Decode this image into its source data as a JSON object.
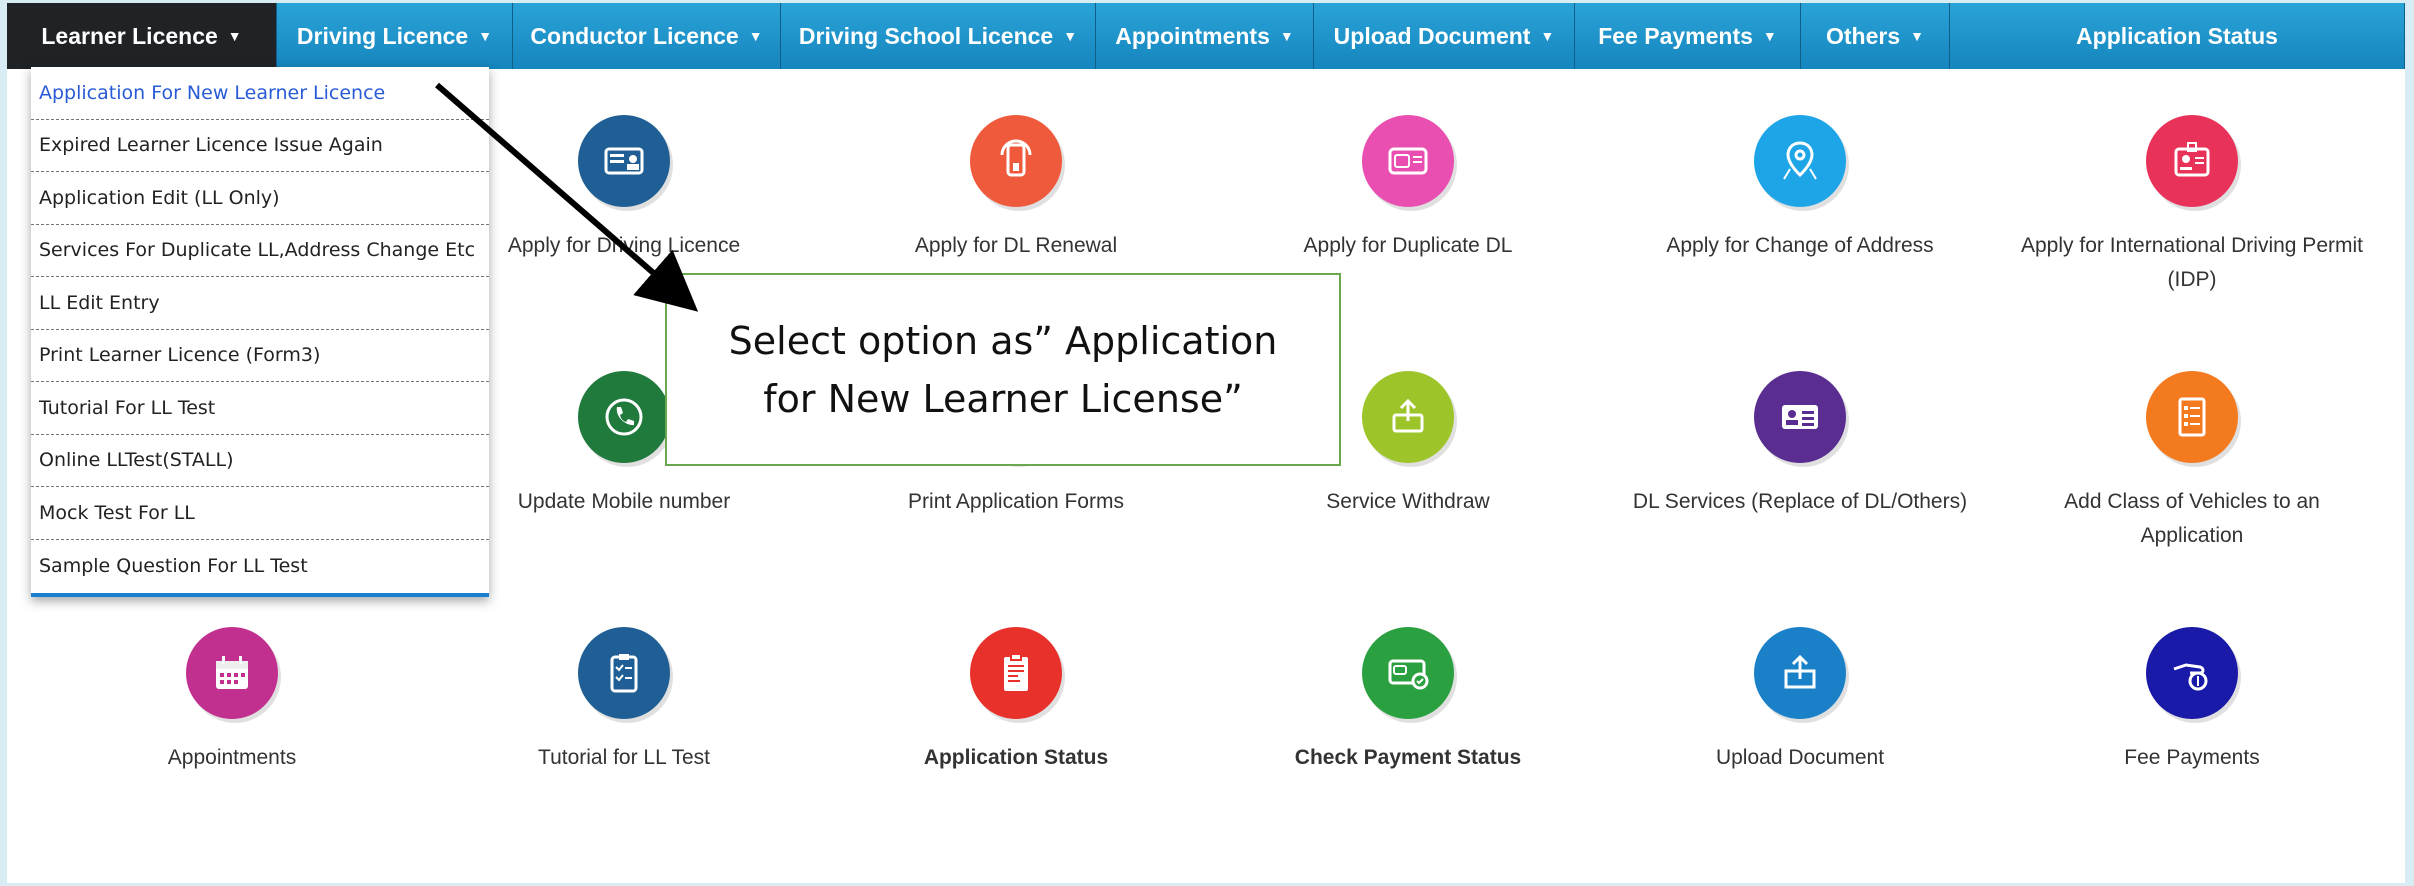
{
  "navbar": {
    "items": [
      {
        "label": "Learner Licence",
        "width": 270,
        "active": true
      },
      {
        "label": "Driving Licence",
        "width": 236
      },
      {
        "label": "Conductor Licence",
        "width": 268
      },
      {
        "label": "Driving School Licence",
        "width": 315
      },
      {
        "label": "Appointments",
        "width": 218
      },
      {
        "label": "Upload Document",
        "width": 261
      },
      {
        "label": "Fee Payments",
        "width": 226
      },
      {
        "label": "Others",
        "width": 149
      },
      {
        "label": "Application Status",
        "width": 455
      }
    ]
  },
  "dropdown": {
    "items": [
      "Application For New Learner Licence",
      "Expired Learner Licence Issue Again",
      "Application Edit (LL Only)",
      "Services For Duplicate LL,Address Change Etc",
      "LL Edit Entry",
      "Print Learner Licence (Form3)",
      "Tutorial For LL Test",
      "Online LLTest(STALL)",
      "Mock Test For LL",
      "Sample Question For LL Test"
    ]
  },
  "tiles": {
    "row1": [
      {
        "label": "Apply for Driving Licence",
        "color": "#1f5f95",
        "icon": "id-card-icon"
      },
      {
        "label": "Apply for DL Renewal",
        "color": "#f05a3c",
        "icon": "renewal-icon"
      },
      {
        "label": "Apply for Duplicate DL",
        "color": "#e94fb0",
        "icon": "duplicate-card-icon"
      },
      {
        "label": "Apply for Change of Address",
        "color": "#1ea5e8",
        "icon": "map-pin-icon"
      },
      {
        "label": "Apply for International Driving Permit (IDP)",
        "color": "#e8325a",
        "icon": "badge-icon"
      }
    ],
    "row2": [
      {
        "label": "Update Mobile number",
        "color": "#1f7a3c",
        "icon": "phone-icon"
      },
      {
        "label": "Print Application Forms",
        "color": "#f0a030",
        "icon": "print-icon"
      },
      {
        "label": "Service Withdraw",
        "color": "#9dc52a",
        "icon": "withdraw-icon"
      },
      {
        "label": "DL Services (Replace of DL/Others)",
        "color": "#5a2d91",
        "icon": "dl-services-icon"
      },
      {
        "label": "Add Class of Vehicles to an Application",
        "color": "#f47a20",
        "icon": "list-form-icon"
      }
    ],
    "row3": [
      {
        "label": "Appointments",
        "color": "#c2308f",
        "icon": "calendar-icon"
      },
      {
        "label": "Tutorial for LL Test",
        "color": "#1f5f95",
        "icon": "checklist-icon"
      },
      {
        "label": "Application Status",
        "color": "#e8312a",
        "icon": "status-doc-icon",
        "bold": true
      },
      {
        "label": "Check Payment Status",
        "color": "#2aa040",
        "icon": "payment-card-icon",
        "bold": true
      },
      {
        "label": "Upload Document",
        "color": "#1a80c8",
        "icon": "upload-icon"
      },
      {
        "label": "Fee Payments",
        "color": "#1a1aa8",
        "icon": "hand-coin-icon"
      }
    ]
  },
  "callout": {
    "text": "Select  option as” Application for New Learner License”"
  }
}
